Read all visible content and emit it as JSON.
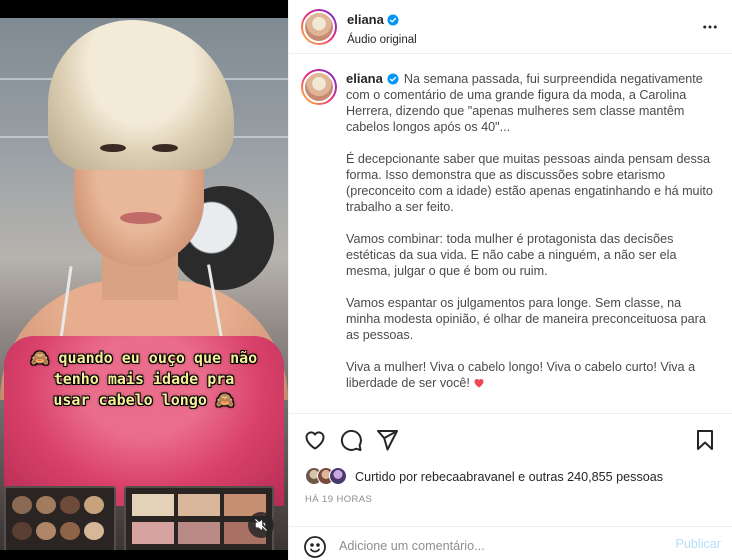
{
  "video": {
    "caption_lines": [
      "🙈 quando eu ouço que não",
      "tenho mais idade pra",
      "usar cabelo longo 🙈"
    ],
    "mute_icon": "speaker-muted-icon"
  },
  "header": {
    "username": "eliana",
    "subtitle": "Áudio original",
    "more_icon": "more-horizontal-icon"
  },
  "post": {
    "username": "eliana",
    "paragraphs": [
      "Na semana passada, fui surpreendida negativamente com o comentário de uma grande figura da moda, a Carolina Herrera, dizendo que \"apenas mulheres sem classe mantêm cabelos longos após os 40\"...",
      "É decepcionante saber que muitas pessoas ainda pensam dessa forma. Isso demonstra que as discussões sobre etarismo (preconceito com a idade) estão apenas engatinhando e há muito trabalho a ser feito.",
      "Vamos combinar: toda mulher é protagonista das decisões estéticas da sua vida. E não cabe a ninguém, a não ser ela mesma, julgar o que é bom ou ruim.",
      "Vamos espantar os julgamentos para longe. Sem classe, na minha modesta opinião, é olhar de maneira preconceituosa para as pessoas.",
      "Viva a mulher! Viva o cabelo longo! Viva o cabelo curto! Viva a liberdade de ser você!"
    ],
    "heart_emoji": "❤️"
  },
  "actions": {
    "like_icon": "heart-icon",
    "comment_icon": "comment-icon",
    "share_icon": "send-icon",
    "save_icon": "bookmark-icon",
    "liked_by": "Curtido por rebecaabravanel e outras 240,855 pessoas",
    "timestamp": "HÁ 19 HORAS"
  },
  "comment_box": {
    "emoji_icon": "smiley-icon",
    "placeholder": "Adicione um comentário...",
    "post_label": "Publicar"
  },
  "colors": {
    "accent": "#0095f6",
    "post_disabled": "#b2dffc",
    "heart": "#ed4956",
    "caption_text": "#f6ef9a"
  }
}
